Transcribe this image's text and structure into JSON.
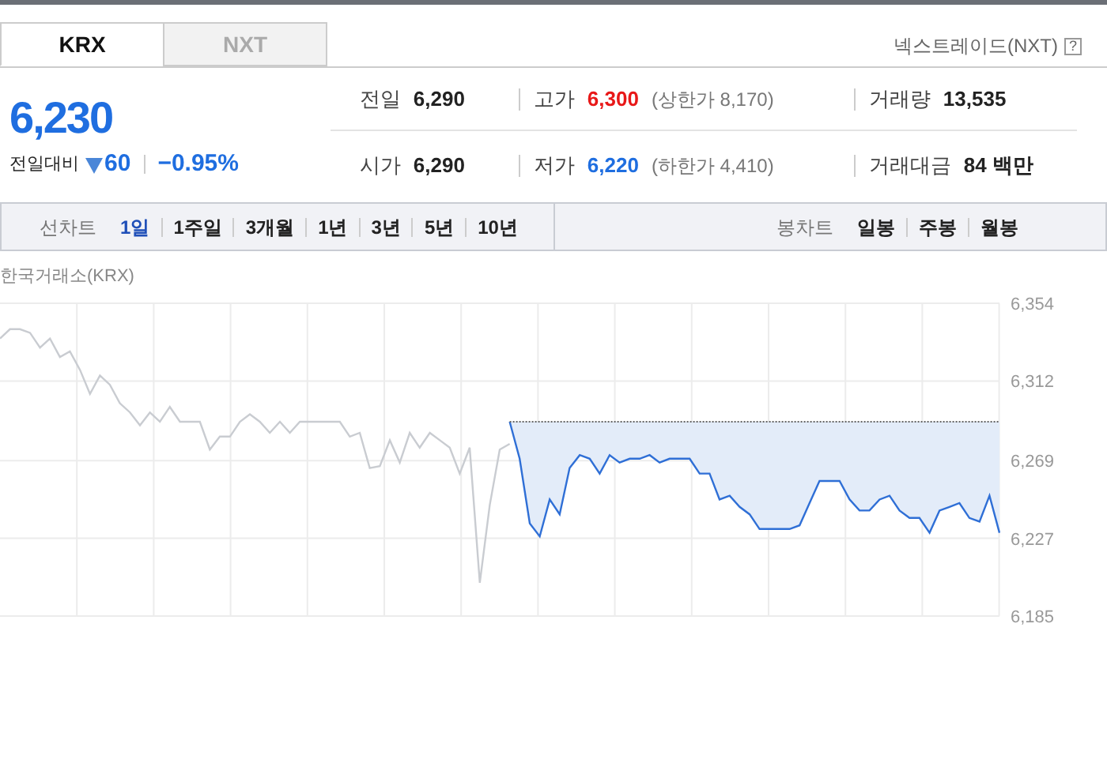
{
  "market_tabs": [
    {
      "label": "KRX",
      "selected": true
    },
    {
      "label": "NXT",
      "selected": false
    }
  ],
  "nxt_link": {
    "label": "넥스트레이드(NXT)",
    "help": "?"
  },
  "price": {
    "current": "6,230",
    "change_label": "전일대비",
    "falling": true,
    "change": "60",
    "change_percent": "−0.95%"
  },
  "stats": [
    {
      "label": "전일",
      "value": "6,290",
      "color": "#222222"
    },
    {
      "label": "고가",
      "value": "6,300",
      "color": "#e81818",
      "limit": "(상한가 8,170)"
    },
    {
      "label": "거래량",
      "value": "13,535",
      "color": "#222222"
    },
    {
      "label": "시가",
      "value": "6,290",
      "color": "#222222"
    },
    {
      "label": "저가",
      "value": "6,220",
      "color": "#1f6ee0",
      "limit": "(하한가 4,410)"
    },
    {
      "label": "거래대금",
      "value": "84 백만",
      "color": "#222222"
    }
  ],
  "line_chart": {
    "label": "선차트",
    "periods": [
      {
        "label": "1일",
        "selected": true
      },
      {
        "label": "1주일",
        "selected": false
      },
      {
        "label": "3개월",
        "selected": false
      },
      {
        "label": "1년",
        "selected": false
      },
      {
        "label": "3년",
        "selected": false
      },
      {
        "label": "5년",
        "selected": false
      },
      {
        "label": "10년",
        "selected": false
      }
    ]
  },
  "candle_chart": {
    "label": "봉차트",
    "periods": [
      {
        "label": "일봉",
        "selected": false
      },
      {
        "label": "주봉",
        "selected": false
      },
      {
        "label": "월봉",
        "selected": false
      }
    ]
  },
  "chart": {
    "source": "한국거래소(KRX)",
    "chart_data": {
      "type": "line",
      "ylim": [
        6185,
        6354
      ],
      "yticks": [
        {
          "value": 6354,
          "label": "6,354"
        },
        {
          "value": 6312,
          "label": "6,312"
        },
        {
          "value": 6269,
          "label": "6,269"
        },
        {
          "value": 6227,
          "label": "6,227"
        },
        {
          "value": 6185,
          "label": "6,185"
        }
      ],
      "series": [
        {
          "color": "#c9ccd1",
          "values": [
            6335,
            6340,
            6340,
            6338,
            6330,
            6335,
            6325,
            6328,
            6318,
            6305,
            6315,
            6310,
            6300,
            6295,
            6288,
            6295,
            6290,
            6298,
            6290,
            6290,
            6290,
            6275,
            6282,
            6282,
            6290,
            6294,
            6290,
            6284,
            6290,
            6284,
            6290,
            6290,
            6290,
            6290,
            6290,
            6282,
            6284,
            6265,
            6266,
            6280,
            6268,
            6284,
            6276,
            6284,
            6280,
            6276,
            6262,
            6276,
            6203,
            6245,
            6275,
            6278,
            null,
            null,
            null,
            null,
            null,
            null,
            null,
            null,
            null,
            null,
            null,
            null,
            null,
            null,
            null,
            null,
            null,
            null,
            null,
            null,
            null,
            null,
            null,
            null,
            null,
            null,
            null,
            null,
            null,
            null,
            null,
            null,
            null,
            null,
            null,
            null,
            null,
            null,
            null,
            null,
            null,
            null,
            null,
            null,
            null,
            null,
            null,
            null,
            null
          ]
        },
        {
          "color": "#2f6fd6",
          "values": [
            null,
            null,
            null,
            null,
            null,
            null,
            null,
            null,
            null,
            null,
            null,
            null,
            null,
            null,
            null,
            null,
            null,
            null,
            null,
            null,
            null,
            null,
            null,
            null,
            null,
            null,
            null,
            null,
            null,
            null,
            null,
            null,
            null,
            null,
            null,
            null,
            null,
            null,
            null,
            null,
            null,
            null,
            null,
            null,
            null,
            null,
            null,
            null,
            null,
            null,
            null,
            6290,
            6270,
            6235,
            6228,
            6248,
            6240,
            6265,
            6272,
            6270,
            6262,
            6272,
            6268,
            6270,
            6270,
            6272,
            6268,
            6270,
            6270,
            6270,
            6262,
            6262,
            6248,
            6250,
            6244,
            6240,
            6232,
            6232,
            6232,
            6232,
            6234,
            6246,
            6258,
            6258,
            6258,
            6248,
            6242,
            6242,
            6248,
            6250,
            6242,
            6238,
            6238,
            6230,
            6242,
            6244,
            6246,
            6238,
            6236,
            6250,
            6230
          ]
        },
        {
          "color": "#666666",
          "line_style": "dotted",
          "values": [
            null,
            null,
            null,
            null,
            null,
            null,
            null,
            null,
            null,
            null,
            null,
            null,
            null,
            null,
            null,
            null,
            null,
            null,
            null,
            null,
            null,
            null,
            null,
            null,
            null,
            null,
            null,
            null,
            null,
            null,
            null,
            null,
            null,
            null,
            null,
            null,
            null,
            null,
            null,
            null,
            null,
            null,
            null,
            null,
            null,
            null,
            null,
            null,
            null,
            null,
            null,
            6290,
            6290,
            6290,
            6290,
            6290,
            6290,
            6290,
            6290,
            6290,
            6290,
            6290,
            6290,
            6290,
            6290,
            6290,
            6290,
            6290,
            6290,
            6290,
            6290,
            6290,
            6290,
            6290,
            6290,
            6290,
            6290,
            6290,
            6290,
            6290,
            6290,
            6290,
            6290,
            6290,
            6290,
            6290,
            6290,
            6290,
            6290,
            6290,
            6290,
            6290,
            6290,
            6290,
            6290,
            6290,
            6290,
            6290,
            6290,
            6290,
            6290
          ]
        }
      ],
      "grid": true
    }
  }
}
